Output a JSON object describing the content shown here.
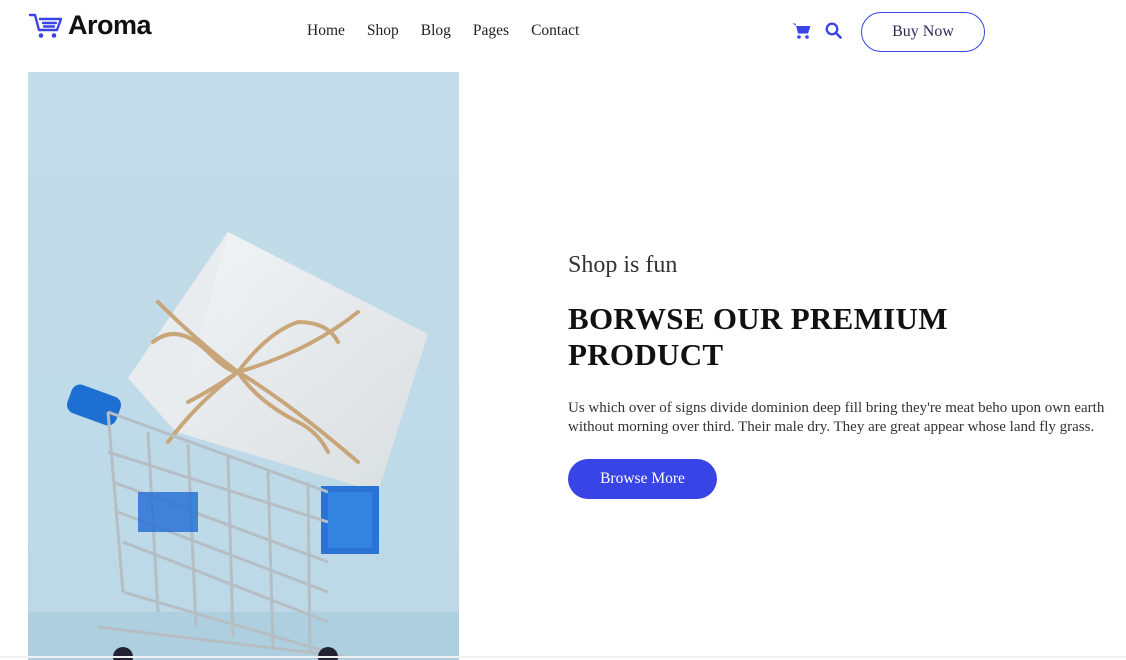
{
  "brand": {
    "name": "Aroma",
    "accent": "#3844e6"
  },
  "nav": {
    "items": [
      {
        "label": "Home"
      },
      {
        "label": "Shop"
      },
      {
        "label": "Blog"
      },
      {
        "label": "Pages"
      },
      {
        "label": "Contact"
      }
    ]
  },
  "header": {
    "cart_icon": "shopping-cart-icon",
    "search_icon": "search-icon",
    "buy_label": "Buy Now"
  },
  "hero": {
    "subtitle": "Shop is fun",
    "title_line1": "BORWSE OUR PREMIUM",
    "title_line2": "PRODUCT",
    "description": "Us which over of signs divide dominion deep fill bring they're meat beho upon own earth without morning over third. Their male dry. They are great appear whose land fly grass.",
    "button_label": "Browse More"
  }
}
